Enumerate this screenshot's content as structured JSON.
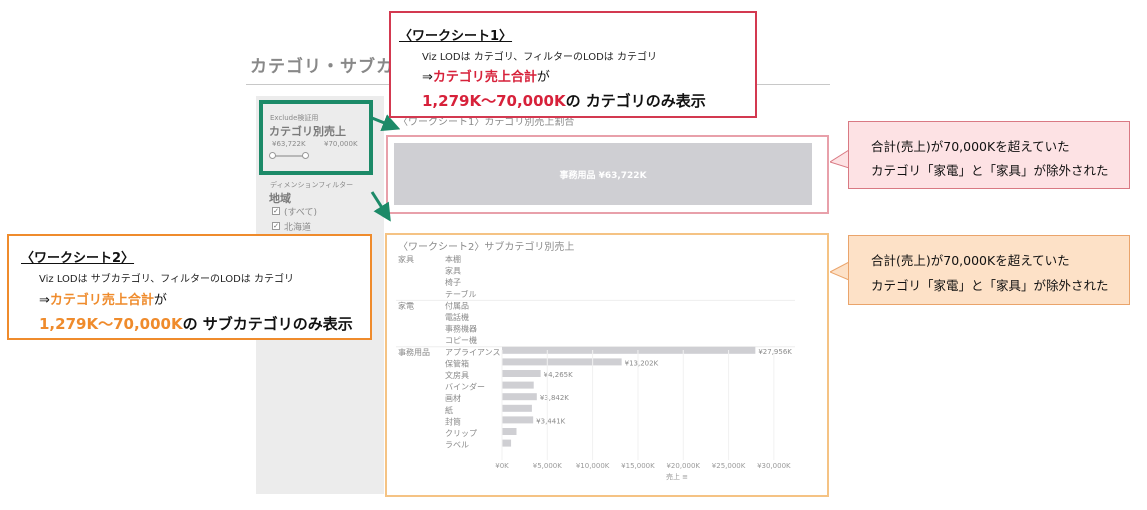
{
  "dashboard": {
    "title": "カテゴリ・サブカ",
    "filter": {
      "param_caption": "Exclude検証用",
      "param_title": "カテゴリ別売上",
      "range_min": "¥63,722K",
      "range_max": "¥70,000K",
      "dim_caption": "ディメンションフィルター",
      "dim_title": "地域",
      "items": [
        "(すべて)",
        "北海道"
      ]
    },
    "ws1": {
      "title": "〈ワークシート1〉カテゴリ別売上割合",
      "bar_label": "事務用品 ¥63,722K"
    },
    "ws2": {
      "title": "〈ワークシート2〉サブカテゴリ別売上",
      "x_axis_label": "売上 ≡"
    }
  },
  "callout1": {
    "title": "〈ワークシート1〉",
    "line1": "Viz LODは カテゴリ、フィルターのLODは カテゴリ",
    "arrow": "⇒",
    "highlight1": "カテゴリ売上合計",
    "suffix1": "が",
    "highlight2": "1,279K～70,000K",
    "suffix2": "の カテゴリのみ表示"
  },
  "callout2": {
    "title": "〈ワークシート2〉",
    "line1": "Viz LODは サブカテゴリ、フィルターのLODは カテゴリ",
    "arrow": "⇒",
    "highlight1": "カテゴリ売上合計",
    "suffix1": "が",
    "highlight2": "1,279K～70,000K",
    "suffix2": "の サブカテゴリのみ表示"
  },
  "note1": {
    "line1": "合計(売上)が70,000Kを超えていた",
    "line2": "カテゴリ「家電」と「家具」が除外された"
  },
  "note2": {
    "line1": "合計(売上)が70,000Kを超えていた",
    "line2": "カテゴリ「家電」と「家具」が除外された"
  },
  "colors": {
    "callout1_border": "#d33950",
    "callout2_border": "#ef8b2c",
    "highlight_red": "#d7213a",
    "highlight_orange": "#ef8b2c",
    "green_frame": "#1c8a68",
    "bar_gray": "#cfcfd3"
  },
  "chart_data": {
    "type": "bar",
    "orientation": "horizontal",
    "groups": [
      {
        "category": "家具",
        "subcategories": [
          "本棚",
          "家具",
          "椅子",
          "テーブル"
        ],
        "values": [
          null,
          null,
          null,
          null
        ]
      },
      {
        "category": "家電",
        "subcategories": [
          "付属品",
          "電話機",
          "事務機器",
          "コピー機"
        ],
        "values": [
          null,
          null,
          null,
          null
        ]
      },
      {
        "category": "事務用品",
        "subcategories": [
          "アプライアンス",
          "保管箱",
          "文房具",
          "バインダー",
          "画材",
          "紙",
          "封筒",
          "クリップ",
          "ラベル"
        ],
        "values": [
          27956,
          13202,
          4265,
          3500,
          3842,
          3300,
          3441,
          1600,
          1000
        ],
        "labels": [
          "¥27,956K",
          "¥13,202K",
          "¥4,265K",
          "",
          "¥3,842K",
          "",
          "¥3,441K",
          "",
          ""
        ]
      }
    ],
    "x_ticks": [
      "¥0K",
      "¥5,000K",
      "¥10,000K",
      "¥15,000K",
      "¥20,000K",
      "¥25,000K",
      "¥30,000K"
    ],
    "x_tick_values": [
      0,
      5000,
      10000,
      15000,
      20000,
      25000,
      30000
    ],
    "xlim": [
      0,
      32000
    ],
    "xlabel": "売上"
  }
}
